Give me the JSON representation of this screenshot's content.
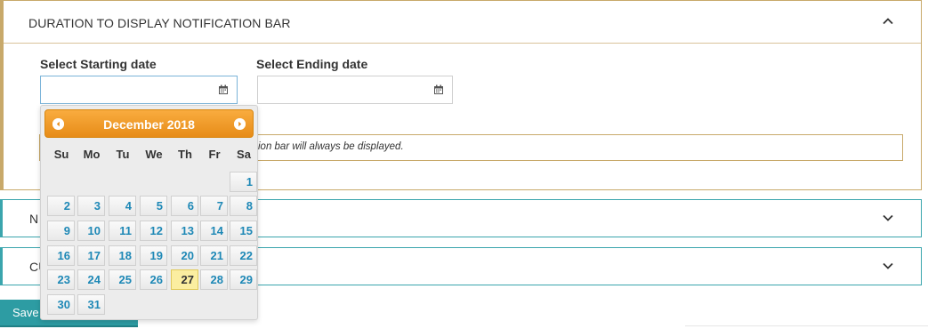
{
  "duration_panel": {
    "title": "DURATION TO DISPLAY NOTIFICATION BAR",
    "start_label": "Select Starting date",
    "end_label": "Select Ending date",
    "start_value": "",
    "end_value": "",
    "note_text": "ion bar will always be displayed."
  },
  "panel_n": {
    "title": "N"
  },
  "panel_c": {
    "title": "CU"
  },
  "save_button": {
    "label": "Save"
  },
  "datepicker": {
    "month_year": "December 2018",
    "weekdays": [
      "Su",
      "Mo",
      "Tu",
      "We",
      "Th",
      "Fr",
      "Sa"
    ],
    "days": [
      "1",
      "2",
      "3",
      "4",
      "5",
      "6",
      "7",
      "8",
      "9",
      "10",
      "11",
      "12",
      "13",
      "14",
      "15",
      "16",
      "17",
      "18",
      "19",
      "20",
      "21",
      "22",
      "23",
      "24",
      "25",
      "26",
      "27",
      "28",
      "29",
      "30",
      "31"
    ],
    "selected_day": "27",
    "accent_color": "#f0a030"
  },
  "icons": {
    "collapse": "chevron-up-icon",
    "expand": "chevron-down-icon",
    "calendar": "calendar-icon",
    "prev": "prev-month-icon",
    "next": "next-month-icon"
  },
  "colors": {
    "panel_border": "#c8a96a",
    "teal": "#2d9ca3",
    "today": "#fbeea0",
    "day_text": "#1e88b6"
  }
}
